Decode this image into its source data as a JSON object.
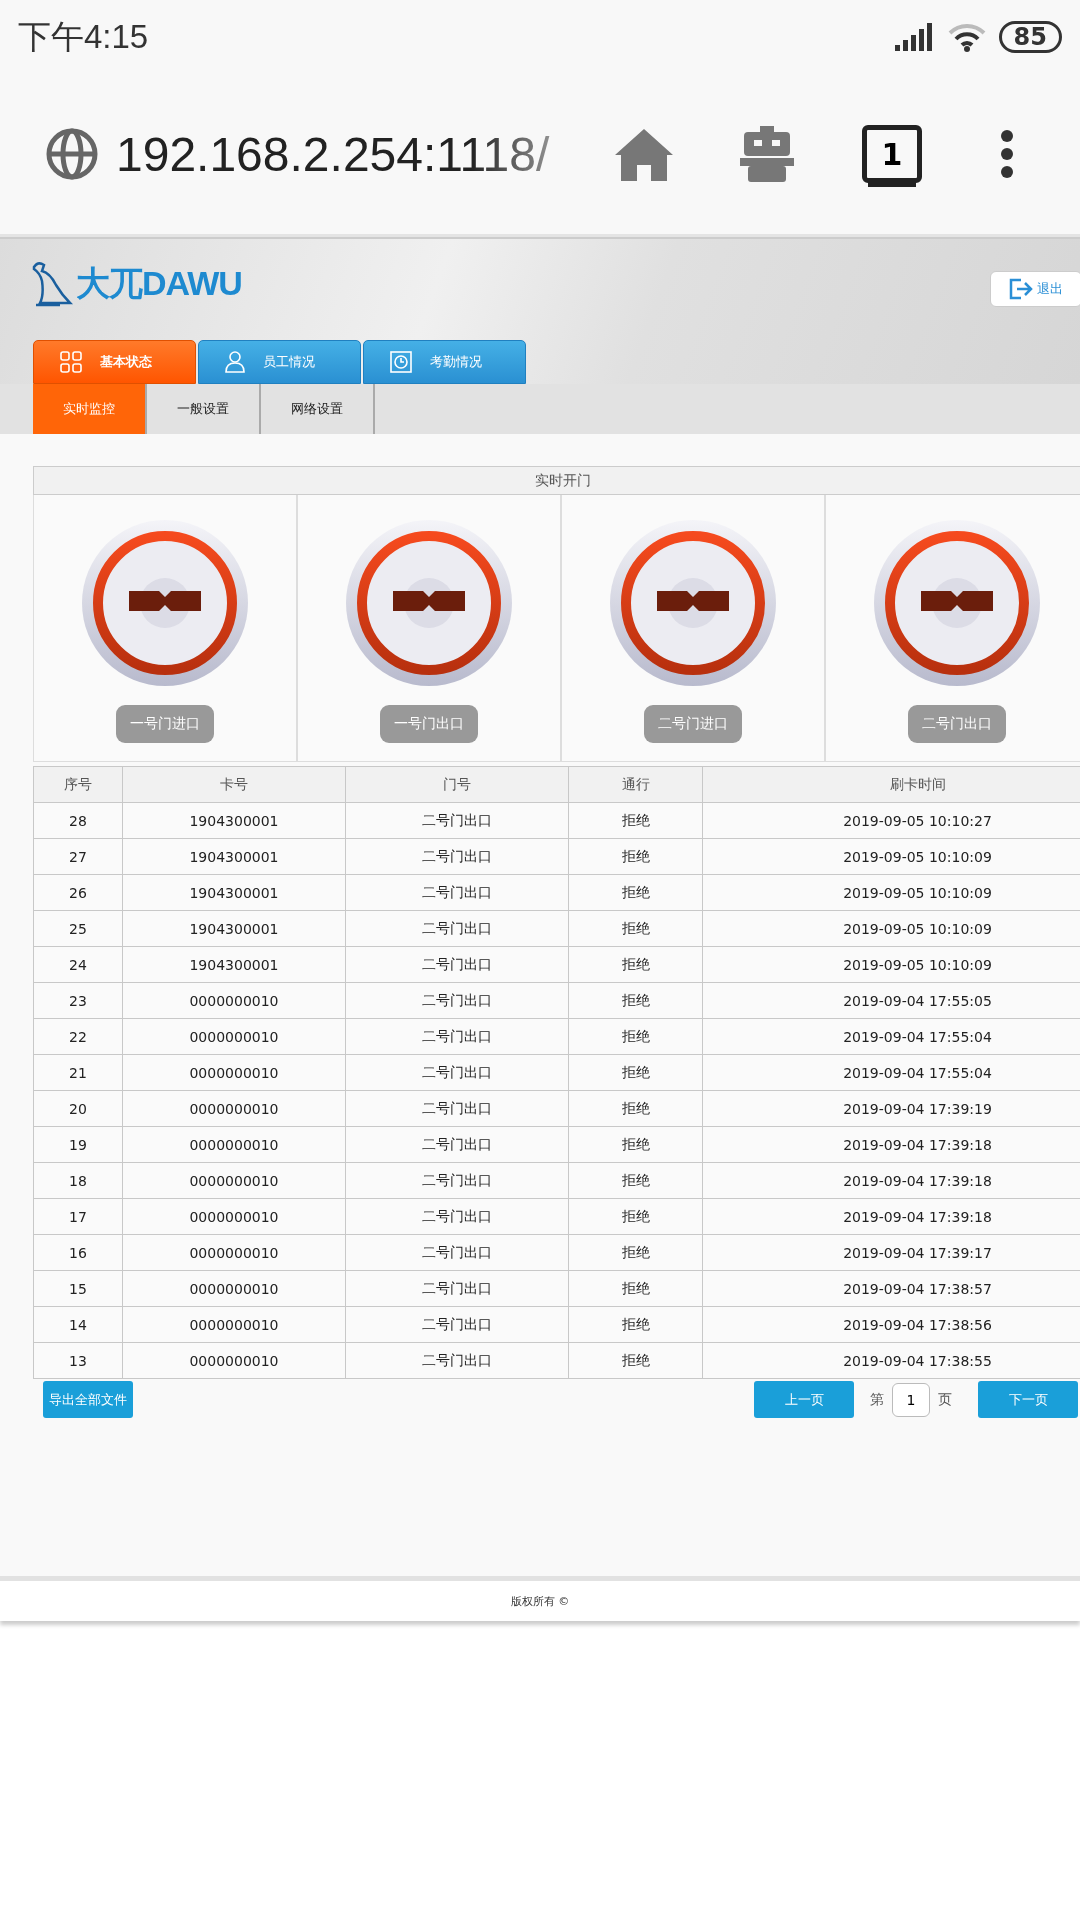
{
  "status_bar": {
    "time": "下午4:15",
    "battery": "85"
  },
  "browser": {
    "url": "192.168.2.254:1118/",
    "tab_count": "1"
  },
  "header": {
    "logo_text": "大兀DAWU",
    "logout": "退出"
  },
  "main_tabs": [
    {
      "label": "基本状态",
      "selected": true
    },
    {
      "label": "员工情况",
      "selected": false
    },
    {
      "label": "考勤情况",
      "selected": false
    }
  ],
  "sub_tabs": [
    {
      "label": "实时监控",
      "selected": true
    },
    {
      "label": "一般设置",
      "selected": false
    },
    {
      "label": "网络设置",
      "selected": false
    }
  ],
  "doors": {
    "title": "实时开门",
    "items": [
      {
        "label": "一号门进口"
      },
      {
        "label": "一号门出口"
      },
      {
        "label": "二号门进口"
      },
      {
        "label": "二号门出口"
      }
    ]
  },
  "table": {
    "columns": [
      "序号",
      "卡号",
      "门号",
      "通行",
      "刷卡时间"
    ],
    "rows": [
      [
        "28",
        "1904300001",
        "二号门出口",
        "拒绝",
        "2019-09-05 10:10:27"
      ],
      [
        "27",
        "1904300001",
        "二号门出口",
        "拒绝",
        "2019-09-05 10:10:09"
      ],
      [
        "26",
        "1904300001",
        "二号门出口",
        "拒绝",
        "2019-09-05 10:10:09"
      ],
      [
        "25",
        "1904300001",
        "二号门出口",
        "拒绝",
        "2019-09-05 10:10:09"
      ],
      [
        "24",
        "1904300001",
        "二号门出口",
        "拒绝",
        "2019-09-05 10:10:09"
      ],
      [
        "23",
        "0000000010",
        "二号门出口",
        "拒绝",
        "2019-09-04 17:55:05"
      ],
      [
        "22",
        "0000000010",
        "二号门出口",
        "拒绝",
        "2019-09-04 17:55:04"
      ],
      [
        "21",
        "0000000010",
        "二号门出口",
        "拒绝",
        "2019-09-04 17:55:04"
      ],
      [
        "20",
        "0000000010",
        "二号门出口",
        "拒绝",
        "2019-09-04 17:39:19"
      ],
      [
        "19",
        "0000000010",
        "二号门出口",
        "拒绝",
        "2019-09-04 17:39:18"
      ],
      [
        "18",
        "0000000010",
        "二号门出口",
        "拒绝",
        "2019-09-04 17:39:18"
      ],
      [
        "17",
        "0000000010",
        "二号门出口",
        "拒绝",
        "2019-09-04 17:39:18"
      ],
      [
        "16",
        "0000000010",
        "二号门出口",
        "拒绝",
        "2019-09-04 17:39:17"
      ],
      [
        "15",
        "0000000010",
        "二号门出口",
        "拒绝",
        "2019-09-04 17:38:57"
      ],
      [
        "14",
        "0000000010",
        "二号门出口",
        "拒绝",
        "2019-09-04 17:38:56"
      ],
      [
        "13",
        "0000000010",
        "二号门出口",
        "拒绝",
        "2019-09-04 17:38:55"
      ]
    ]
  },
  "pagination": {
    "export": "导出全部文件",
    "prev": "上一页",
    "page_prefix": "第",
    "page": "1",
    "page_suffix": "页",
    "next": "下一页"
  },
  "footer": "版权所有 ©"
}
